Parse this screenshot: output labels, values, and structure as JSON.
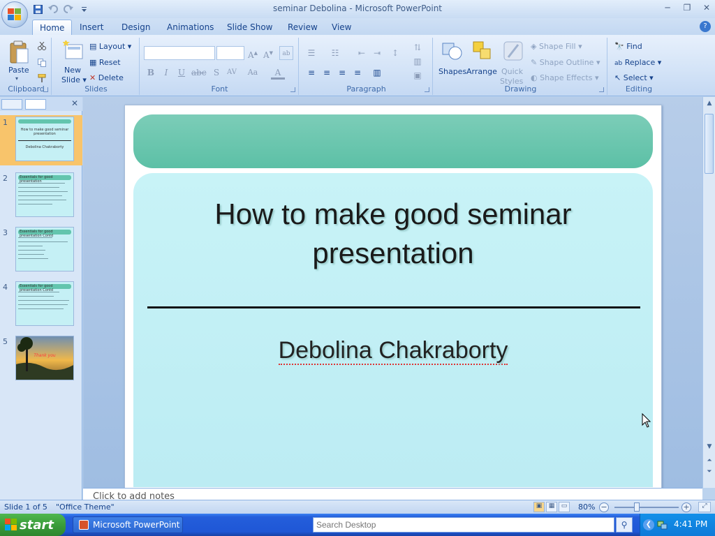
{
  "window": {
    "title": "seminar Debolina - Microsoft PowerPoint"
  },
  "qat": {
    "save_icon": "save-icon",
    "undo_icon": "undo-icon",
    "redo_icon": "redo-icon",
    "customize_icon": "dropdown-icon"
  },
  "tabs": [
    "Home",
    "Insert",
    "Design",
    "Animations",
    "Slide Show",
    "Review",
    "View"
  ],
  "ribbon": {
    "clipboard": {
      "label": "Clipboard",
      "paste": "Paste"
    },
    "slides": {
      "label": "Slides",
      "new_slide_1": "New",
      "new_slide_2": "Slide",
      "layout": "Layout",
      "reset": "Reset",
      "delete": "Delete"
    },
    "font": {
      "label": "Font"
    },
    "paragraph": {
      "label": "Paragraph"
    },
    "drawing": {
      "label": "Drawing",
      "shapes": "Shapes",
      "arrange": "Arrange",
      "quick_1": "Quick",
      "quick_2": "Styles",
      "shape_fill": "Shape Fill",
      "shape_outline": "Shape Outline",
      "shape_effects": "Shape Effects"
    },
    "editing": {
      "label": "Editing",
      "find": "Find",
      "replace": "Replace",
      "select": "Select"
    }
  },
  "slides_pane": {
    "thumbnails": [
      {
        "num": "1",
        "title": "How to make good seminar presentation",
        "sub": "Debolina Chakraborty"
      },
      {
        "num": "2",
        "title": "Essentials for good presentation"
      },
      {
        "num": "3",
        "title": "Essentials for good presentation Contd"
      },
      {
        "num": "4",
        "title": "Essentials for good presentation Contd"
      },
      {
        "num": "5",
        "title": "Thank you"
      }
    ]
  },
  "slide": {
    "title_line1": "How to make good seminar",
    "title_line2": "presentation",
    "subtitle": "Debolina Chakraborty",
    "colors": {
      "header": "#63c5ae",
      "body": "#c5f0f5"
    }
  },
  "notes": {
    "placeholder": "Click to add notes"
  },
  "status": {
    "slide": "Slide 1 of 5",
    "theme": "\"Office Theme\"",
    "zoom": "80%"
  },
  "taskbar": {
    "start": "start",
    "app": "Microsoft PowerPoint ...",
    "search_placeholder": "Search Desktop",
    "time": "4:41 PM"
  }
}
